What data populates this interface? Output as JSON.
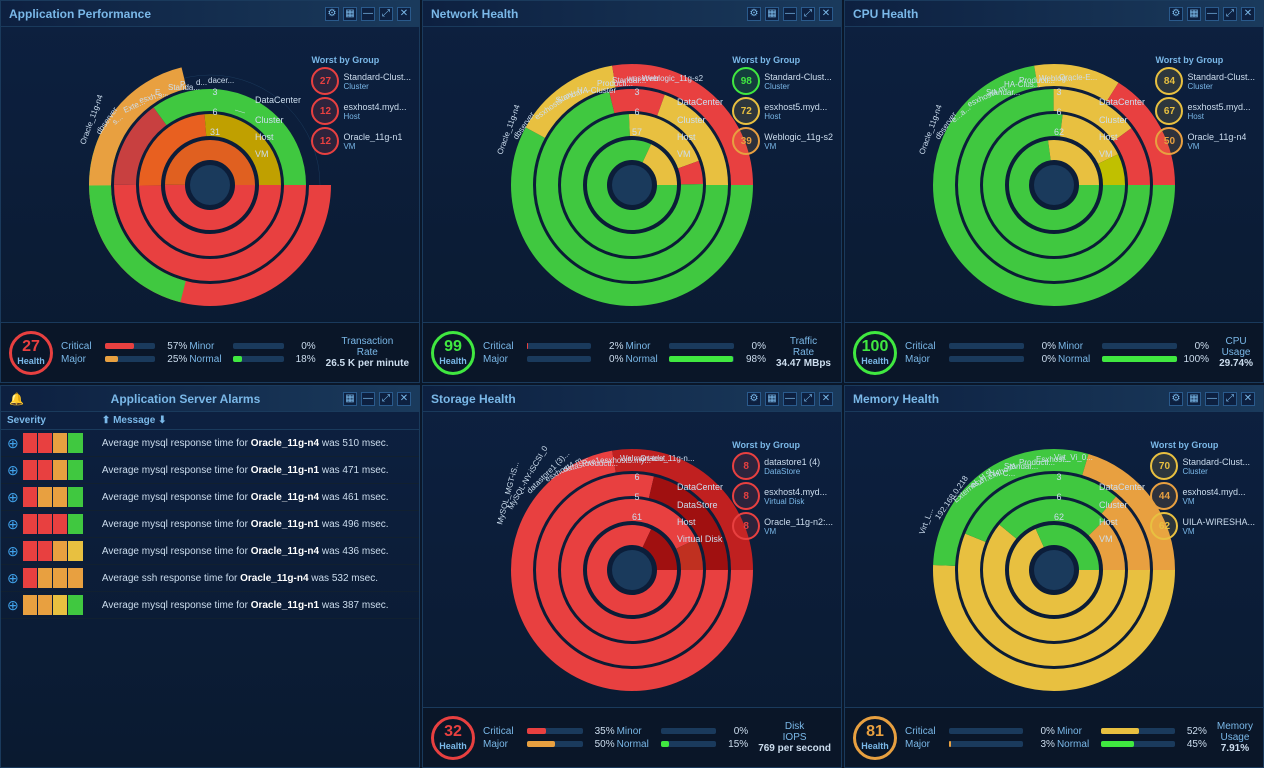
{
  "panels": {
    "app_perf": {
      "title": "Application Performance",
      "health": 27,
      "health_color": "red",
      "health_label": "Health",
      "stats": {
        "critical": {
          "pct": 57,
          "color": "red"
        },
        "minor": {
          "pct": 0,
          "color": "green"
        },
        "major": {
          "pct": 25,
          "color": "orange"
        },
        "normal": {
          "pct": 18,
          "color": "green"
        }
      },
      "metric_name": "Transaction Rate",
      "metric_value": "26.5 K per minute",
      "worst_by_group_title": "Worst by Group",
      "worst_items": [
        {
          "label": "27",
          "color": "red",
          "name": "Standard-Clust...",
          "type": "Cluster"
        },
        {
          "label": "12",
          "color": "red",
          "name": "esxhost4.myd...",
          "type": "Host"
        },
        {
          "label": "12",
          "color": "red",
          "name": "Oracle_11g-n1",
          "type": "VM"
        }
      ],
      "ring_labels": [
        "DataCenter",
        "Cluster",
        "Host",
        "VM"
      ]
    },
    "network": {
      "title": "Network Health",
      "health": 99,
      "health_color": "green",
      "health_label": "Health",
      "stats": {
        "critical": {
          "pct": 2,
          "color": "red"
        },
        "minor": {
          "pct": 0,
          "color": "green"
        },
        "major": {
          "pct": 0,
          "color": "orange"
        },
        "normal": {
          "pct": 98,
          "color": "green"
        }
      },
      "metric_name": "Traffic Rate",
      "metric_value": "34.47 MBps",
      "worst_by_group_title": "Worst by Group",
      "worst_items": [
        {
          "label": "98",
          "color": "green",
          "name": "Standard-Clust...",
          "type": "Cluster"
        },
        {
          "label": "72",
          "color": "yellow",
          "name": "esxhost5.myd...",
          "type": "Host"
        },
        {
          "label": "39",
          "color": "orange",
          "name": "Weblogic_11g-s2",
          "type": "VM"
        }
      ],
      "ring_labels": [
        "DataCenter",
        "Cluster",
        "Host",
        "VM"
      ]
    },
    "cpu": {
      "title": "CPU Health",
      "health": 100,
      "health_color": "green",
      "health_label": "Health",
      "stats": {
        "critical": {
          "pct": 0,
          "color": "red"
        },
        "minor": {
          "pct": 0,
          "color": "green"
        },
        "major": {
          "pct": 0,
          "color": "orange"
        },
        "normal": {
          "pct": 100,
          "color": "green"
        }
      },
      "metric_name": "CPU Usage",
      "metric_value": "29.74%",
      "worst_by_group_title": "Worst by Group",
      "worst_items": [
        {
          "label": "84",
          "color": "yellow",
          "name": "Standard-Clust...",
          "type": "Cluster"
        },
        {
          "label": "67",
          "color": "yellow",
          "name": "esxhost5.myd...",
          "type": "Host"
        },
        {
          "label": "50",
          "color": "orange",
          "name": "Oracle_11g-n4",
          "type": "VM"
        }
      ],
      "ring_labels": [
        "DataCenter",
        "Cluster",
        "Host",
        "VM"
      ]
    },
    "alarms": {
      "title": "Application Server Alarms",
      "columns": [
        "Severity",
        "Message"
      ],
      "rows": [
        {
          "msg_pre": "Average mysql response time for ",
          "bold": "Oracle_11g-n4",
          "msg_post": " was 510 msec.",
          "segs": [
            "red",
            "red",
            "orange",
            "green"
          ]
        },
        {
          "msg_pre": "Average mysql response time for ",
          "bold": "Oracle_11g-n1",
          "msg_post": " was 471 msec.",
          "segs": [
            "red",
            "red",
            "orange",
            "green"
          ]
        },
        {
          "msg_pre": "Average mysql response time for ",
          "bold": "Oracle_11g-n4",
          "msg_post": " was 461 msec.",
          "segs": [
            "red",
            "orange",
            "orange",
            "green"
          ]
        },
        {
          "msg_pre": "Average mysql response time for ",
          "bold": "Oracle_11g-n1",
          "msg_post": " was 496 msec.",
          "segs": [
            "red",
            "red",
            "red",
            "green"
          ]
        },
        {
          "msg_pre": "Average mysql response time for ",
          "bold": "Oracle_11g-n4",
          "msg_post": " was 436 msec.",
          "segs": [
            "red",
            "red",
            "orange",
            "yellow"
          ]
        },
        {
          "msg_pre": "Average ssh response time for ",
          "bold": "Oracle_11g-n4",
          "msg_post": " was 532 msec.",
          "segs": [
            "red",
            "orange",
            "orange",
            "orange"
          ]
        },
        {
          "msg_pre": "Average mysql response time for ",
          "bold": "Oracle_11g-n1",
          "msg_post": " was 387 msec.",
          "segs": [
            "orange",
            "orange",
            "yellow",
            "green"
          ]
        }
      ]
    },
    "storage": {
      "title": "Storage Health",
      "health": 32,
      "health_color": "red",
      "health_label": "Health",
      "stats": {
        "critical": {
          "pct": 35,
          "color": "red"
        },
        "minor": {
          "pct": 0,
          "color": "green"
        },
        "major": {
          "pct": 50,
          "color": "orange"
        },
        "normal": {
          "pct": 15,
          "color": "green"
        }
      },
      "metric_name": "Disk IOPS",
      "metric_value": "769 per second",
      "worst_by_group_title": "Worst by Group",
      "worst_items": [
        {
          "label": "8",
          "color": "red",
          "name": "datastore1 (4)",
          "type": "DataStore"
        },
        {
          "label": "8",
          "color": "red",
          "name": "esxhost4.myd...",
          "type": "Virtual Disk"
        },
        {
          "label": "8",
          "color": "red",
          "name": "Oracle_11g-n2:...",
          "type": "VM"
        }
      ],
      "ring_labels": [
        "DataCenter",
        "DataStore",
        "Host",
        "Virtual Disk"
      ]
    },
    "memory": {
      "title": "Memory Health",
      "health": 81,
      "health_color": "orange",
      "health_label": "Health",
      "stats": {
        "critical": {
          "pct": 0,
          "color": "red"
        },
        "minor": {
          "pct": 52,
          "color": "yellow"
        },
        "major": {
          "pct": 3,
          "color": "orange"
        },
        "normal": {
          "pct": 45,
          "color": "green"
        }
      },
      "metric_name": "Memory Usage",
      "metric_value": "7.91%",
      "worst_by_group_title": "Worst by Group",
      "worst_items": [
        {
          "label": "70",
          "color": "yellow",
          "name": "Standard-Clust...",
          "type": "Cluster"
        },
        {
          "label": "44",
          "color": "orange",
          "name": "esxhost4.myd...",
          "type": "VM"
        },
        {
          "label": "62",
          "color": "yellow",
          "name": "UILA-WIRESHA...",
          "type": "VM"
        }
      ],
      "ring_labels": [
        "DataCenter",
        "Cluster",
        "Host",
        "VM"
      ]
    }
  },
  "controls": {
    "settings": "⚙",
    "minimize": "—",
    "expand": "⤢",
    "close": "✕",
    "grid": "▦"
  }
}
